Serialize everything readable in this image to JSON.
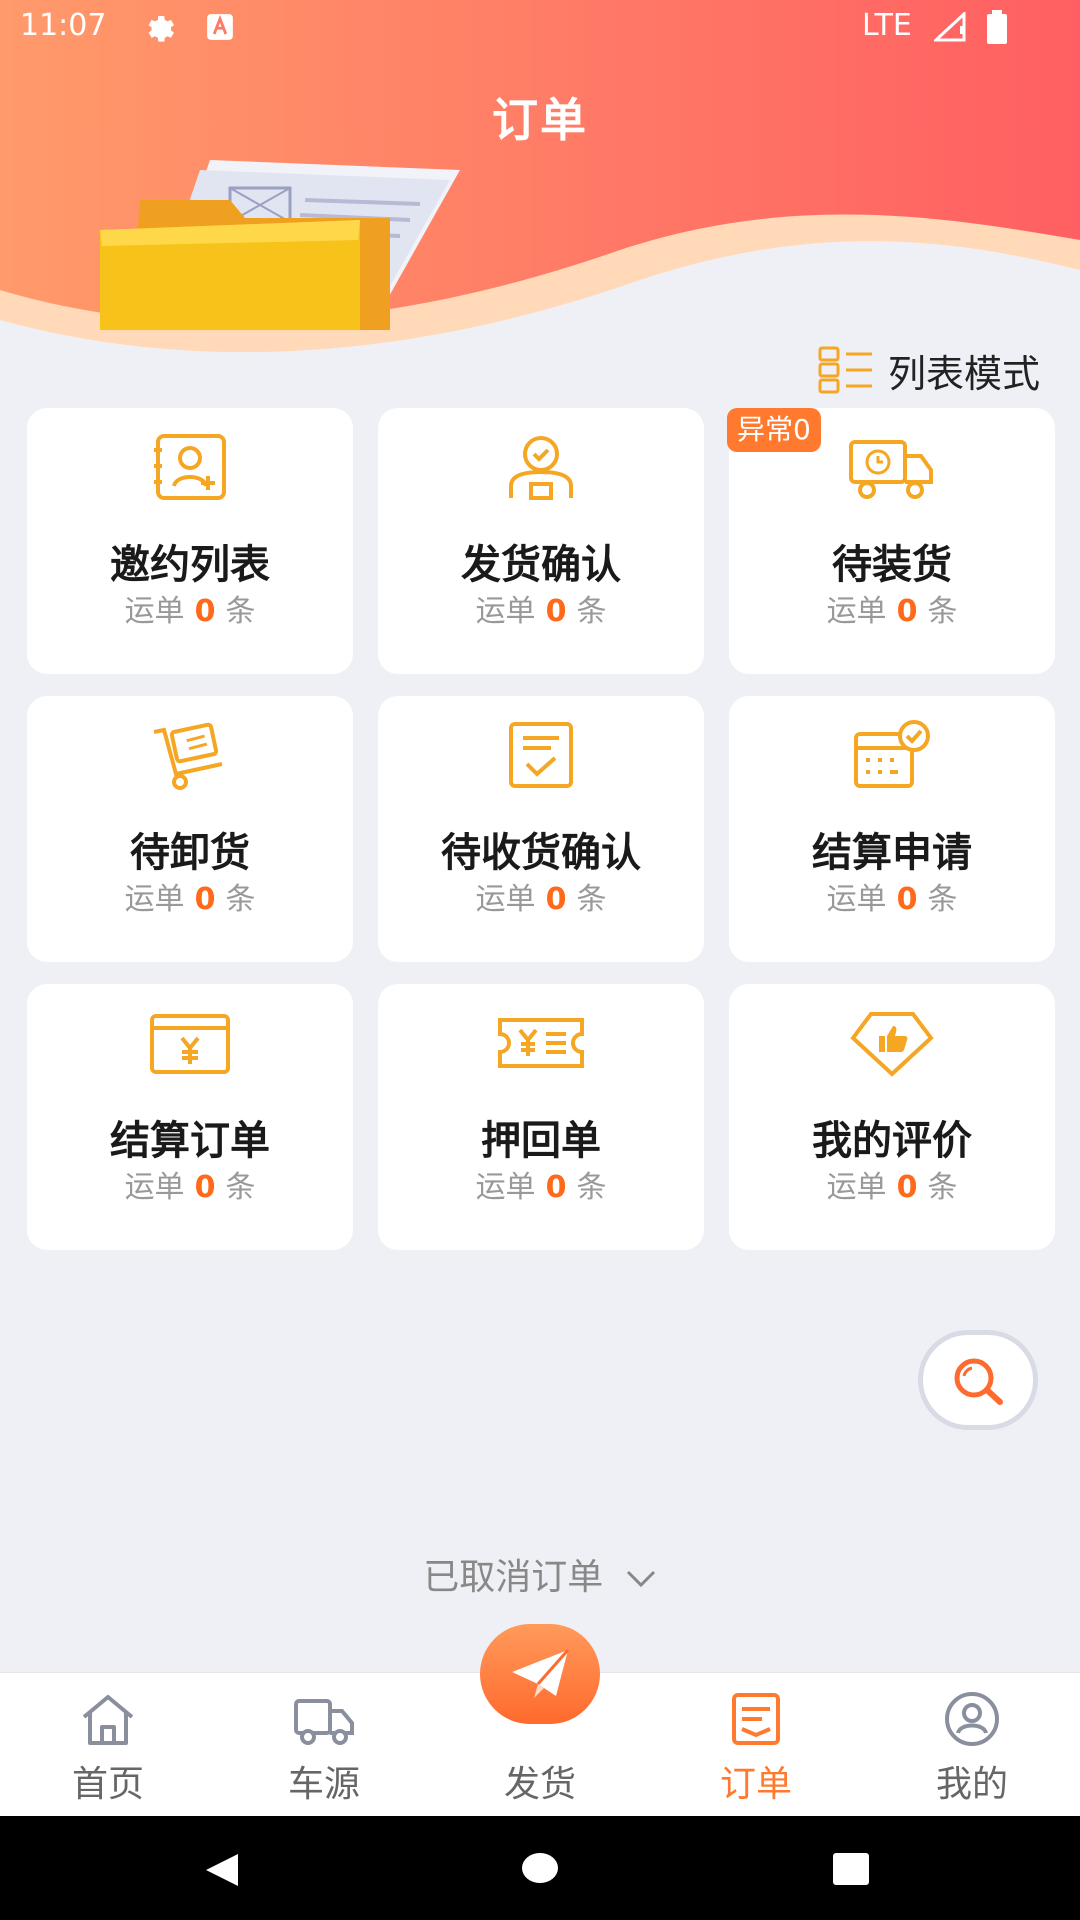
{
  "status_bar": {
    "time": "11:07",
    "network": "LTE"
  },
  "header": {
    "title": "订单"
  },
  "list_mode": {
    "label": "列表模式"
  },
  "cards": [
    {
      "title": "邀约列表",
      "prefix": "运单",
      "count": "0",
      "suffix": "条",
      "icon": "invite-contact-icon"
    },
    {
      "title": "发货确认",
      "prefix": "运单",
      "count": "0",
      "suffix": "条",
      "icon": "driver-icon"
    },
    {
      "title": "待装货",
      "prefix": "运单",
      "count": "0",
      "suffix": "条",
      "icon": "truck-clock-icon",
      "badge": "异常0"
    },
    {
      "title": "待卸货",
      "prefix": "运单",
      "count": "0",
      "suffix": "条",
      "icon": "cart-icon"
    },
    {
      "title": "待收货确认",
      "prefix": "运单",
      "count": "0",
      "suffix": "条",
      "icon": "checklist-icon"
    },
    {
      "title": "结算申请",
      "prefix": "运单",
      "count": "0",
      "suffix": "条",
      "icon": "settlement-check-icon"
    },
    {
      "title": "结算订单",
      "prefix": "运单",
      "count": "0",
      "suffix": "条",
      "icon": "yuan-card-icon"
    },
    {
      "title": "押回单",
      "prefix": "运单",
      "count": "0",
      "suffix": "条",
      "icon": "yuan-ticket-icon"
    },
    {
      "title": "我的评价",
      "prefix": "运单",
      "count": "0",
      "suffix": "条",
      "icon": "thumbs-up-tag-icon"
    }
  ],
  "cancelled": {
    "label": "已取消订单"
  },
  "bottom_nav": {
    "items": [
      {
        "label": "首页",
        "icon": "home-icon"
      },
      {
        "label": "车源",
        "icon": "truck-icon"
      },
      {
        "label": "发货",
        "icon": "paper-plane-icon"
      },
      {
        "label": "订单",
        "icon": "order-icon",
        "active": true
      },
      {
        "label": "我的",
        "icon": "profile-icon"
      }
    ]
  },
  "colors": {
    "accent": "#ff7a2e",
    "icon": "#f5a623",
    "count": "#ff6a1a"
  }
}
